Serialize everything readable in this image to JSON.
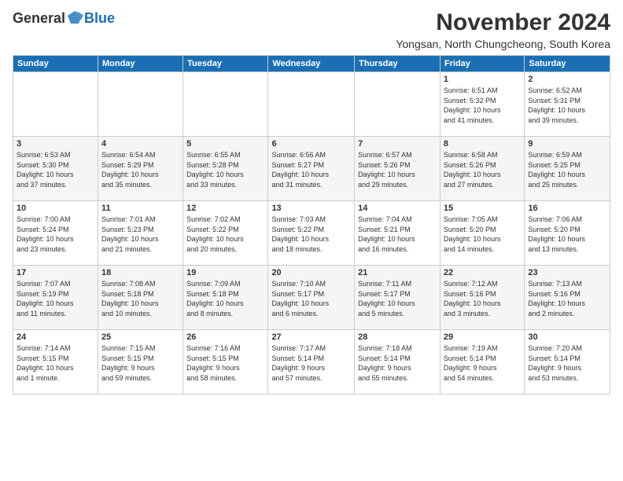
{
  "header": {
    "logo_general": "General",
    "logo_blue": "Blue",
    "month_title": "November 2024",
    "location": "Yongsan, North Chungcheong, South Korea"
  },
  "weekdays": [
    "Sunday",
    "Monday",
    "Tuesday",
    "Wednesday",
    "Thursday",
    "Friday",
    "Saturday"
  ],
  "rows": [
    [
      {
        "day": "",
        "info": ""
      },
      {
        "day": "",
        "info": ""
      },
      {
        "day": "",
        "info": ""
      },
      {
        "day": "",
        "info": ""
      },
      {
        "day": "",
        "info": ""
      },
      {
        "day": "1",
        "info": "Sunrise: 6:51 AM\nSunset: 5:32 PM\nDaylight: 10 hours\nand 41 minutes."
      },
      {
        "day": "2",
        "info": "Sunrise: 6:52 AM\nSunset: 5:31 PM\nDaylight: 10 hours\nand 39 minutes."
      }
    ],
    [
      {
        "day": "3",
        "info": "Sunrise: 6:53 AM\nSunset: 5:30 PM\nDaylight: 10 hours\nand 37 minutes."
      },
      {
        "day": "4",
        "info": "Sunrise: 6:54 AM\nSunset: 5:29 PM\nDaylight: 10 hours\nand 35 minutes."
      },
      {
        "day": "5",
        "info": "Sunrise: 6:55 AM\nSunset: 5:28 PM\nDaylight: 10 hours\nand 33 minutes."
      },
      {
        "day": "6",
        "info": "Sunrise: 6:56 AM\nSunset: 5:27 PM\nDaylight: 10 hours\nand 31 minutes."
      },
      {
        "day": "7",
        "info": "Sunrise: 6:57 AM\nSunset: 5:26 PM\nDaylight: 10 hours\nand 29 minutes."
      },
      {
        "day": "8",
        "info": "Sunrise: 6:58 AM\nSunset: 5:26 PM\nDaylight: 10 hours\nand 27 minutes."
      },
      {
        "day": "9",
        "info": "Sunrise: 6:59 AM\nSunset: 5:25 PM\nDaylight: 10 hours\nand 25 minutes."
      }
    ],
    [
      {
        "day": "10",
        "info": "Sunrise: 7:00 AM\nSunset: 5:24 PM\nDaylight: 10 hours\nand 23 minutes."
      },
      {
        "day": "11",
        "info": "Sunrise: 7:01 AM\nSunset: 5:23 PM\nDaylight: 10 hours\nand 21 minutes."
      },
      {
        "day": "12",
        "info": "Sunrise: 7:02 AM\nSunset: 5:22 PM\nDaylight: 10 hours\nand 20 minutes."
      },
      {
        "day": "13",
        "info": "Sunrise: 7:03 AM\nSunset: 5:22 PM\nDaylight: 10 hours\nand 18 minutes."
      },
      {
        "day": "14",
        "info": "Sunrise: 7:04 AM\nSunset: 5:21 PM\nDaylight: 10 hours\nand 16 minutes."
      },
      {
        "day": "15",
        "info": "Sunrise: 7:05 AM\nSunset: 5:20 PM\nDaylight: 10 hours\nand 14 minutes."
      },
      {
        "day": "16",
        "info": "Sunrise: 7:06 AM\nSunset: 5:20 PM\nDaylight: 10 hours\nand 13 minutes."
      }
    ],
    [
      {
        "day": "17",
        "info": "Sunrise: 7:07 AM\nSunset: 5:19 PM\nDaylight: 10 hours\nand 11 minutes."
      },
      {
        "day": "18",
        "info": "Sunrise: 7:08 AM\nSunset: 5:18 PM\nDaylight: 10 hours\nand 10 minutes."
      },
      {
        "day": "19",
        "info": "Sunrise: 7:09 AM\nSunset: 5:18 PM\nDaylight: 10 hours\nand 8 minutes."
      },
      {
        "day": "20",
        "info": "Sunrise: 7:10 AM\nSunset: 5:17 PM\nDaylight: 10 hours\nand 6 minutes."
      },
      {
        "day": "21",
        "info": "Sunrise: 7:11 AM\nSunset: 5:17 PM\nDaylight: 10 hours\nand 5 minutes."
      },
      {
        "day": "22",
        "info": "Sunrise: 7:12 AM\nSunset: 5:16 PM\nDaylight: 10 hours\nand 3 minutes."
      },
      {
        "day": "23",
        "info": "Sunrise: 7:13 AM\nSunset: 5:16 PM\nDaylight: 10 hours\nand 2 minutes."
      }
    ],
    [
      {
        "day": "24",
        "info": "Sunrise: 7:14 AM\nSunset: 5:15 PM\nDaylight: 10 hours\nand 1 minute."
      },
      {
        "day": "25",
        "info": "Sunrise: 7:15 AM\nSunset: 5:15 PM\nDaylight: 9 hours\nand 59 minutes."
      },
      {
        "day": "26",
        "info": "Sunrise: 7:16 AM\nSunset: 5:15 PM\nDaylight: 9 hours\nand 58 minutes."
      },
      {
        "day": "27",
        "info": "Sunrise: 7:17 AM\nSunset: 5:14 PM\nDaylight: 9 hours\nand 57 minutes."
      },
      {
        "day": "28",
        "info": "Sunrise: 7:18 AM\nSunset: 5:14 PM\nDaylight: 9 hours\nand 55 minutes."
      },
      {
        "day": "29",
        "info": "Sunrise: 7:19 AM\nSunset: 5:14 PM\nDaylight: 9 hours\nand 54 minutes."
      },
      {
        "day": "30",
        "info": "Sunrise: 7:20 AM\nSunset: 5:14 PM\nDaylight: 9 hours\nand 53 minutes."
      }
    ]
  ]
}
